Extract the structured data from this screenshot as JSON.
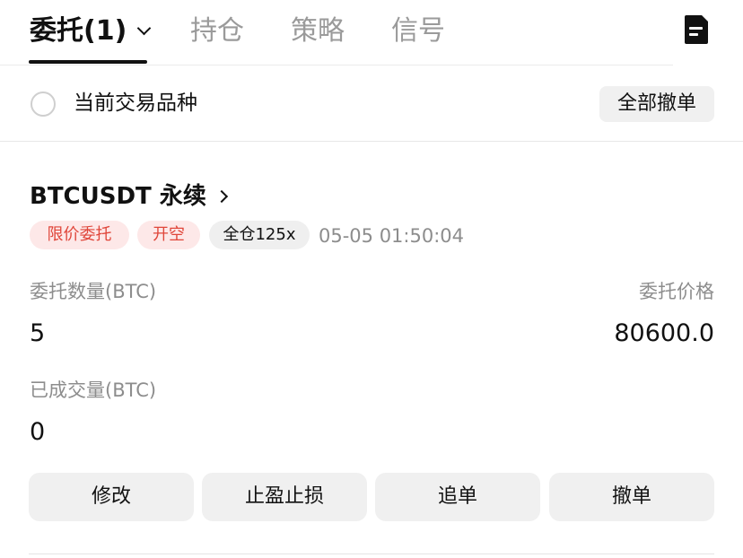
{
  "tabs": {
    "orders_label": "委托(1)",
    "positions_label": "持仓",
    "strategy_label": "策略",
    "signals_label": "信号"
  },
  "filter": {
    "current_symbol_label": "当前交易品种",
    "cancel_all_label": "全部撤单"
  },
  "order": {
    "symbol": "BTCUSDT 永续",
    "tags": {
      "order_type": "限价委托",
      "side": "开空",
      "margin_leverage": "全仓125x"
    },
    "timestamp": "05-05 01:50:04",
    "quantity_label": "委托数量(BTC)",
    "quantity_value": "5",
    "price_label": "委托价格",
    "price_value": "80600.0",
    "filled_label": "已成交量(BTC)",
    "filled_value": "0",
    "actions": {
      "modify": "修改",
      "tp_sl": "止盈止损",
      "chase": "追单",
      "cancel": "撤单"
    }
  },
  "colors": {
    "accent_red": "#e0463a",
    "tag_red_bg": "#fde8e8",
    "button_bg": "#f0f0f0",
    "muted_text": "#8d8d8d"
  }
}
